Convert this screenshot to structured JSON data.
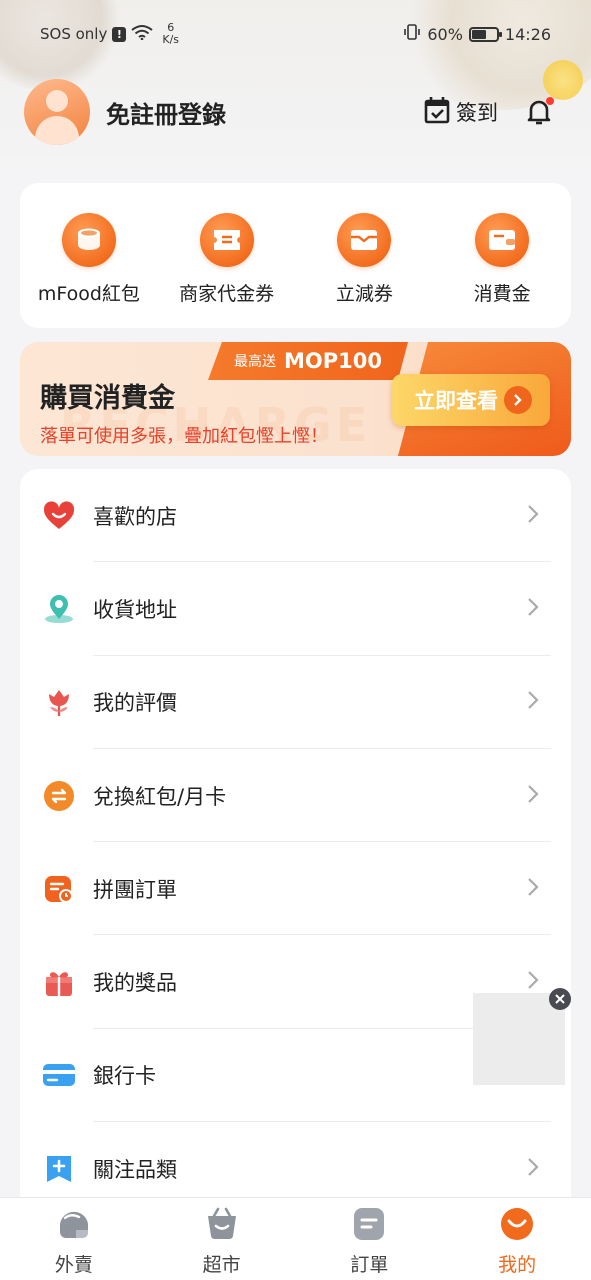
{
  "status_bar": {
    "carrier": "SOS only",
    "alert": "!",
    "net_speed_value": "6",
    "net_speed_unit": "K/s",
    "battery": "60%",
    "time": "14:26"
  },
  "header": {
    "login_label": "免註冊登錄",
    "checkin_label": "簽到"
  },
  "wallet": {
    "items": [
      {
        "label": "mFood紅包",
        "icon": "red-packet-icon"
      },
      {
        "label": "商家代金券",
        "icon": "voucher-icon"
      },
      {
        "label": "立減券",
        "icon": "discount-coupon-icon"
      },
      {
        "label": "消費金",
        "icon": "wallet-icon"
      }
    ]
  },
  "banner": {
    "tag_prefix": "最高送",
    "tag_amount": "MOP100",
    "title": "購買消費金",
    "subtitle": "落單可使用多張，疊加紅包慳上慳！",
    "button_label": "立即查看",
    "watermark": "RECHARGE"
  },
  "menu": {
    "items": [
      {
        "label": "喜歡的店",
        "icon": "heart-icon",
        "color": "#e8413a"
      },
      {
        "label": "收貨地址",
        "icon": "location-pin-icon",
        "color": "#3fbfb0"
      },
      {
        "label": "我的評價",
        "icon": "flower-icon",
        "color": "#e8574f"
      },
      {
        "label": "兌換紅包/月卡",
        "icon": "exchange-icon",
        "color": "#f28a2a"
      },
      {
        "label": "拼團訂單",
        "icon": "group-order-icon",
        "color": "#f0621e"
      },
      {
        "label": "我的獎品",
        "icon": "gift-icon",
        "color": "#ea5a55"
      },
      {
        "label": "銀行卡",
        "icon": "bank-card-icon",
        "color": "#3aa0f0"
      },
      {
        "label": "關注品類",
        "icon": "bookmark-plus-icon",
        "color": "#3aa0f0"
      }
    ]
  },
  "bottom_nav": {
    "items": [
      {
        "label": "外賣",
        "icon": "rider-helmet-icon"
      },
      {
        "label": "超市",
        "icon": "shopping-basket-icon"
      },
      {
        "label": "訂單",
        "icon": "order-list-icon"
      },
      {
        "label": "我的",
        "icon": "smile-profile-icon"
      }
    ],
    "active_index": 3,
    "accent_color": "#f26a1b"
  }
}
